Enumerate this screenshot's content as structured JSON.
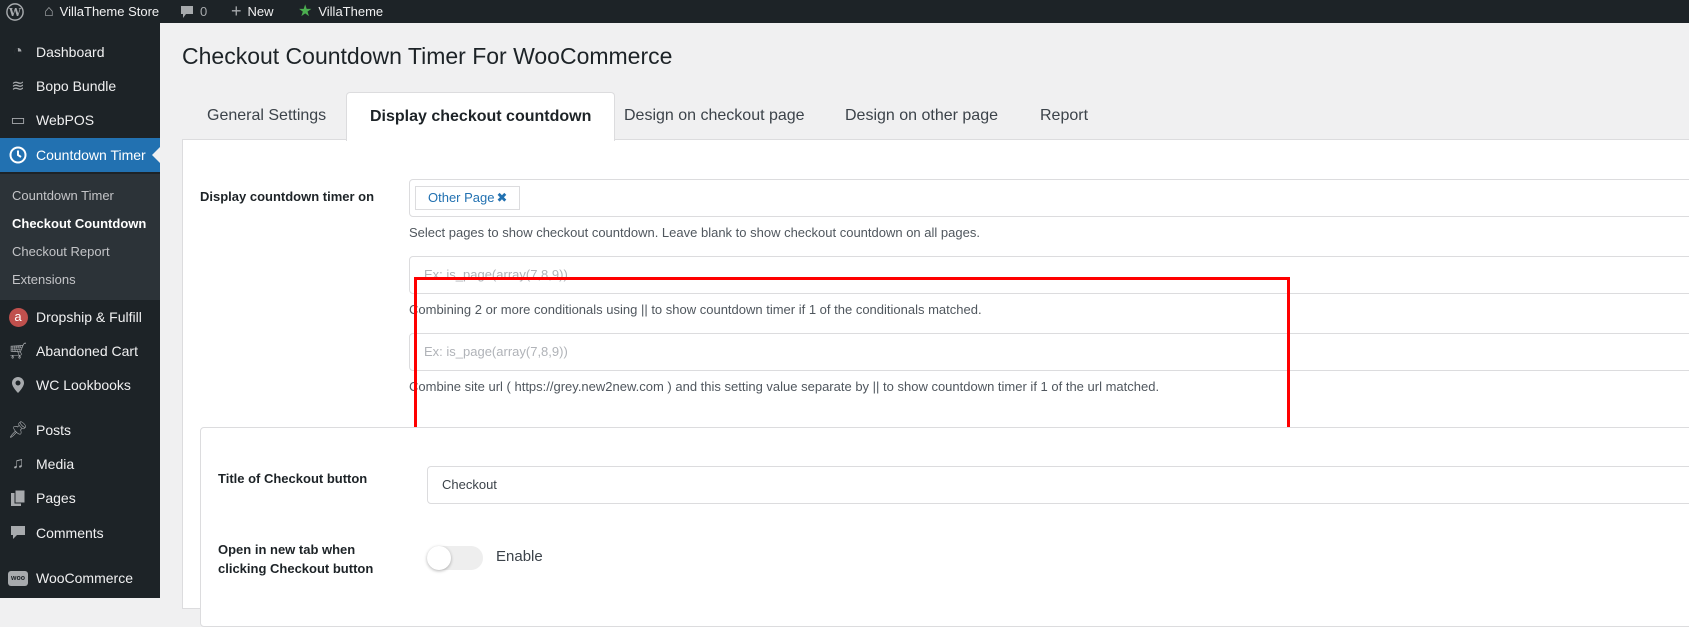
{
  "adminbar": {
    "site_name": "VillaTheme Store",
    "comments_count": "0",
    "new_label": "New",
    "villatheme_label": "VillaTheme"
  },
  "sidebar": {
    "items": [
      {
        "label": "Dashboard",
        "icon": "dashboard-icon"
      },
      {
        "label": "Bopo Bundle",
        "icon": "layers-icon"
      },
      {
        "label": "WebPOS",
        "icon": "monitor-icon"
      },
      {
        "label": "Countdown Timer",
        "icon": "clock-icon",
        "active": true
      },
      {
        "label": "Dropship & Fulfill",
        "icon": "ali-icon"
      },
      {
        "label": "Abandoned Cart",
        "icon": "cart-icon"
      },
      {
        "label": "WC Lookbooks",
        "icon": "location-pin-icon"
      },
      {
        "label": "Posts",
        "icon": "pin-icon"
      },
      {
        "label": "Media",
        "icon": "media-icon"
      },
      {
        "label": "Pages",
        "icon": "pages-icon"
      },
      {
        "label": "Comments",
        "icon": "comment-icon"
      },
      {
        "label": "WooCommerce",
        "icon": "woo-icon"
      }
    ],
    "submenu": [
      {
        "label": "Countdown Timer"
      },
      {
        "label": "Checkout Countdown",
        "current": true
      },
      {
        "label": "Checkout Report"
      },
      {
        "label": "Extensions"
      }
    ]
  },
  "page": {
    "title": "Checkout Countdown Timer For WooCommerce",
    "tabs": [
      {
        "label": "General Settings"
      },
      {
        "label": "Display checkout countdown",
        "active": true
      },
      {
        "label": "Design on checkout page"
      },
      {
        "label": "Design on other page"
      },
      {
        "label": "Report"
      }
    ]
  },
  "display_section": {
    "label": "Display countdown timer on",
    "selected_pages": [
      "Other Page"
    ],
    "pages_help": "Select pages to show checkout countdown. Leave blank to show checkout countdown on all pages.",
    "conditional_placeholder": "Ex: is_page(array(7,8,9))",
    "conditional_value": "",
    "conditional_help": "Combining 2 or more conditionals using || to show countdown timer if 1 of the conditionals matched.",
    "url_placeholder": "Ex: is_page(array(7,8,9))",
    "url_value": "",
    "url_help": "Combine site url ( https://grey.new2new.com ) and this setting value separate by || to show countdown timer if 1 of the url matched."
  },
  "button_section": {
    "title_label": "Title of Checkout button",
    "title_value": "Checkout",
    "newtab_label_line1": "Open in new tab when",
    "newtab_label_line2": "clicking Checkout button",
    "newtab_toggle_label": "Enable",
    "newtab_enabled": false
  },
  "colors": {
    "accent": "#2271b1",
    "highlight_box": "#ff0000",
    "sidebar_bg": "#1d2327"
  }
}
